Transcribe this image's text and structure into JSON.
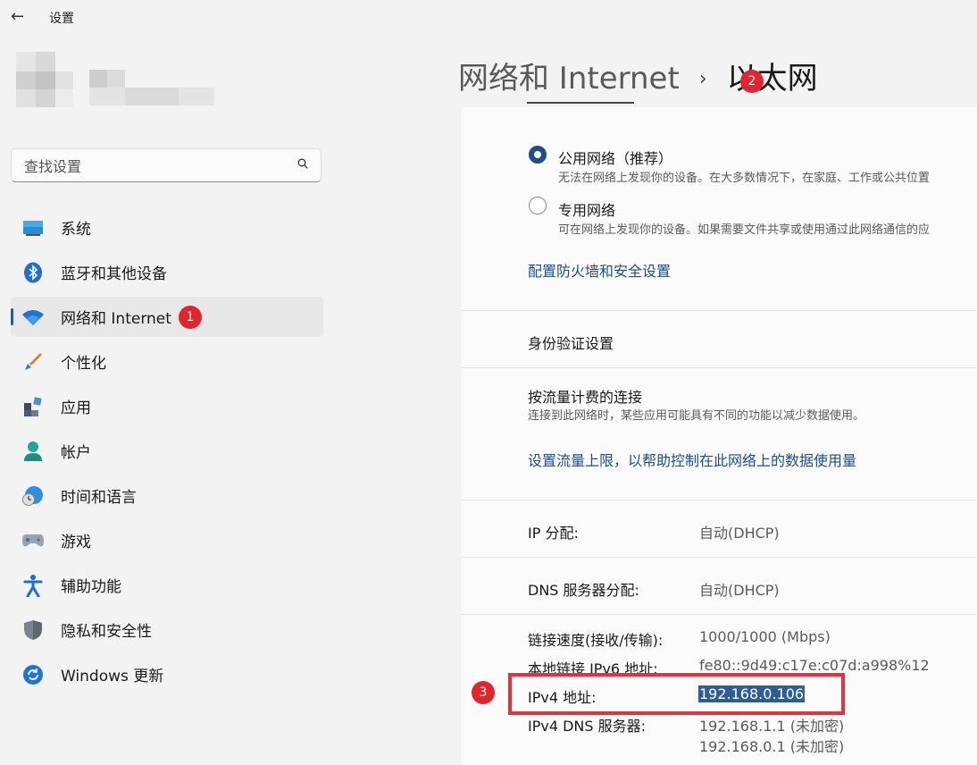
{
  "app": {
    "title": "设置"
  },
  "search": {
    "placeholder": "查找设置"
  },
  "nav": {
    "items": [
      {
        "label": "系统"
      },
      {
        "label": "蓝牙和其他设备"
      },
      {
        "label": "网络和 Internet",
        "badge": "1"
      },
      {
        "label": "个性化"
      },
      {
        "label": "应用"
      },
      {
        "label": "帐户"
      },
      {
        "label": "时间和语言"
      },
      {
        "label": "游戏"
      },
      {
        "label": "辅助功能"
      },
      {
        "label": "隐私和安全性"
      },
      {
        "label": "Windows 更新"
      }
    ]
  },
  "header": {
    "parent": "网络和 Internet",
    "separator": "›",
    "current": "以太网",
    "badge": "2"
  },
  "network_profile": {
    "public": {
      "label": "公用网络（推荐）",
      "desc": "无法在网络上发现你的设备。在大多数情况下，在家庭、工作或公共位置"
    },
    "private": {
      "label": "专用网络",
      "desc": "可在网络上发现你的设备。如果需要文件共享或使用通过此网络通信的应"
    },
    "firewall_link": "配置防火墙和安全设置"
  },
  "auth": {
    "label": "身份验证设置"
  },
  "metered": {
    "label": "按流量计费的连接",
    "desc": "连接到此网络时，某些应用可能具有不同的功能以减少数据使用。",
    "limit_link": "设置流量上限，以帮助控制在此网络上的数据使用量"
  },
  "ip": {
    "label": "IP 分配:",
    "value": "自动(DHCP)"
  },
  "dns": {
    "label": "DNS 服务器分配:",
    "value": "自动(DHCP)"
  },
  "props": {
    "speed_label": "链接速度(接收/传输):",
    "speed_value": "1000/1000 (Mbps)",
    "ipv6_label": "本地链接 IPv6 地址:",
    "ipv6_value": "fe80::9d49:c17e:c07d:a998%12",
    "ipv4_label": "IPv4 地址:",
    "ipv4_value": "192.168.0.106",
    "ipv4dns_label": "IPv4 DNS 服务器:",
    "ipv4dns_value1": "192.168.1.1 (未加密)",
    "ipv4dns_value2": "192.168.0.1 (未加密)",
    "badge": "3"
  },
  "colors": {
    "accent": "#1a5fb4",
    "badge_red": "#e0262c",
    "highlight_box": "#e53238"
  }
}
